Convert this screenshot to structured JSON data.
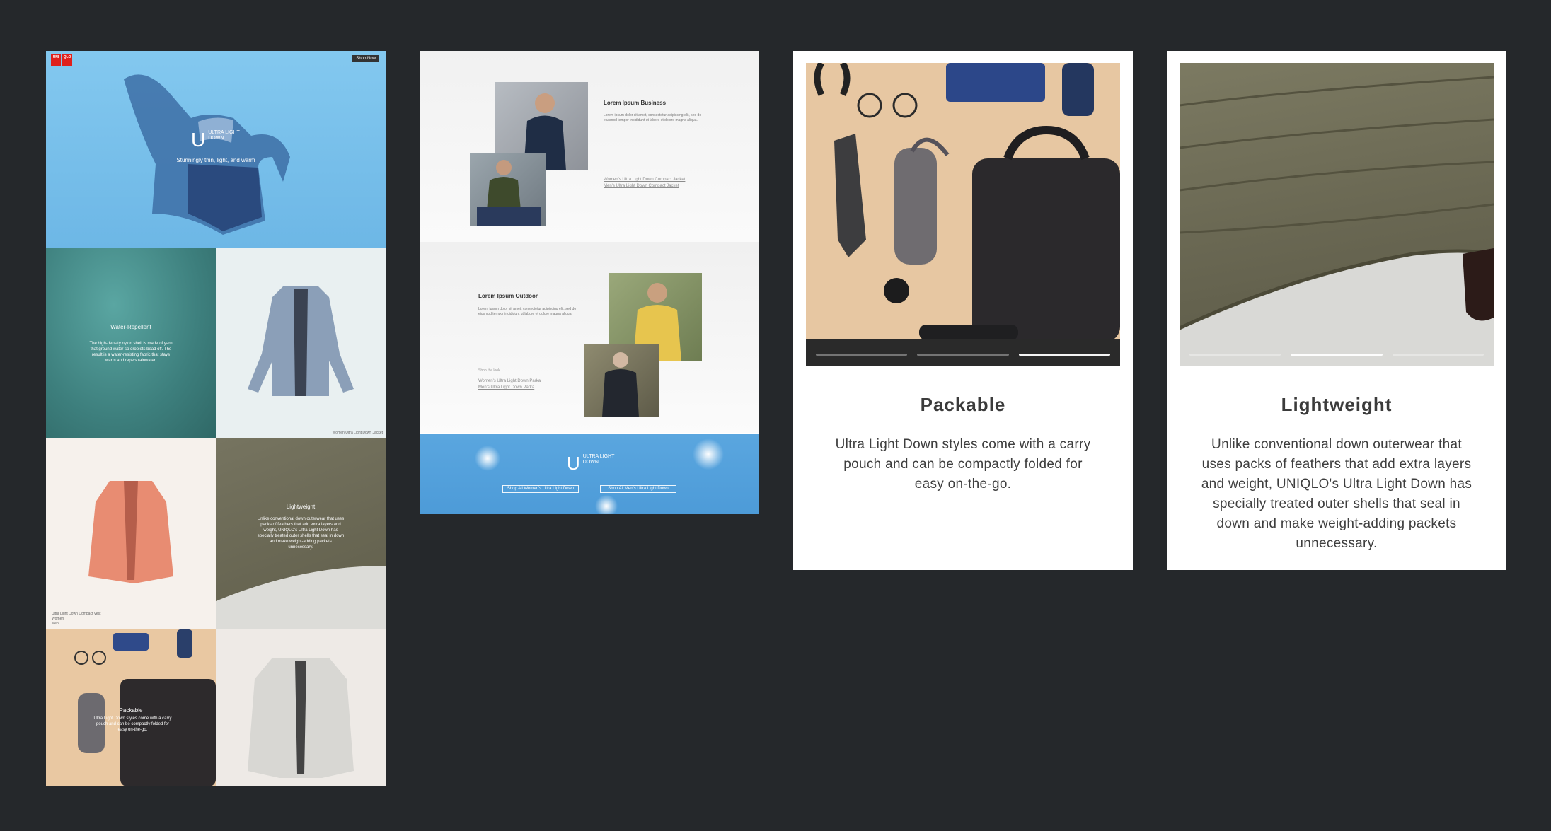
{
  "panel1": {
    "logo": {
      "top": "UNI QLO"
    },
    "shop_now": "Shop Now",
    "hero": {
      "logo_letters": "ULTRA LIGHT DOWN",
      "tagline": "Stunningly thin, light, and warm"
    },
    "water": {
      "title": "Water-Repellent",
      "body": "The high-density nylon shell is made of yarn that ground water so droplets bead off. The result is a water-resisting fabric that stays warm and repels rainwater."
    },
    "jacket_caption": "Women Ultra Light Down Jacket",
    "vest_caption": {
      "line1": "Ultra Light Down Compact Vest",
      "line2": "Women",
      "line3": "Men"
    },
    "light": {
      "title": "Lightweight",
      "body": "Unlike conventional down outerwear that uses packs of feathers that add extra layers and weight, UNIQLO's Ultra Light Down has specially treated outer shells that seal in down and make weight-adding packets unnecessary."
    },
    "pack": {
      "title": "Packable",
      "body": "Ultra Light Down styles come with a carry pouch and can be compactly folded for easy on-the-go."
    }
  },
  "panel2": {
    "business": {
      "title": "Lorem Ipsum Business",
      "body": "Lorem ipsum dolor sit amet, consectetur adipiscing elit, sed do eiusmod tempor incididunt ut labore et dolore magna aliqua.",
      "link1": "Women's Ultra Light Down Compact Jacket",
      "link2": "Men's Ultra Light Down Compact Jacket"
    },
    "outdoor": {
      "title": "Lorem Ipsum Outdoor",
      "body": "Lorem ipsum dolor sit amet, consectetur adipiscing elit, sed do eiusmod tempor incididunt ut labore et dolore magna aliqua.",
      "shop_label": "Shop the look",
      "link1": "Women's Ultra Light Down Parka",
      "link2": "Men's Ultra Light Down Parka"
    },
    "banner": {
      "logo": "ULTRA LIGHT DOWN",
      "btn_women": "Shop All Women's Ultra Light Down",
      "btn_men": "Shop All Men's Ultra Light Down"
    }
  },
  "card_packable": {
    "title": "Packable",
    "body": "Ultra Light Down styles come with a carry pouch and can be compactly folded for easy on-the-go.",
    "active_slide": 3
  },
  "card_lightweight": {
    "title": "Lightweight",
    "body": "Unlike conventional down outerwear that uses packs of feathers that add extra layers and weight, UNIQLO's Ultra Light Down has specially treated outer shells that seal in down and make weight-adding packets unnecessary.",
    "active_slide": 2
  },
  "colors": {
    "background": "#25282b",
    "sky": "#79c0ea",
    "teal": "#4a8e8c",
    "olive": "#6c6a55",
    "uniqlo_red": "#e0201b"
  }
}
